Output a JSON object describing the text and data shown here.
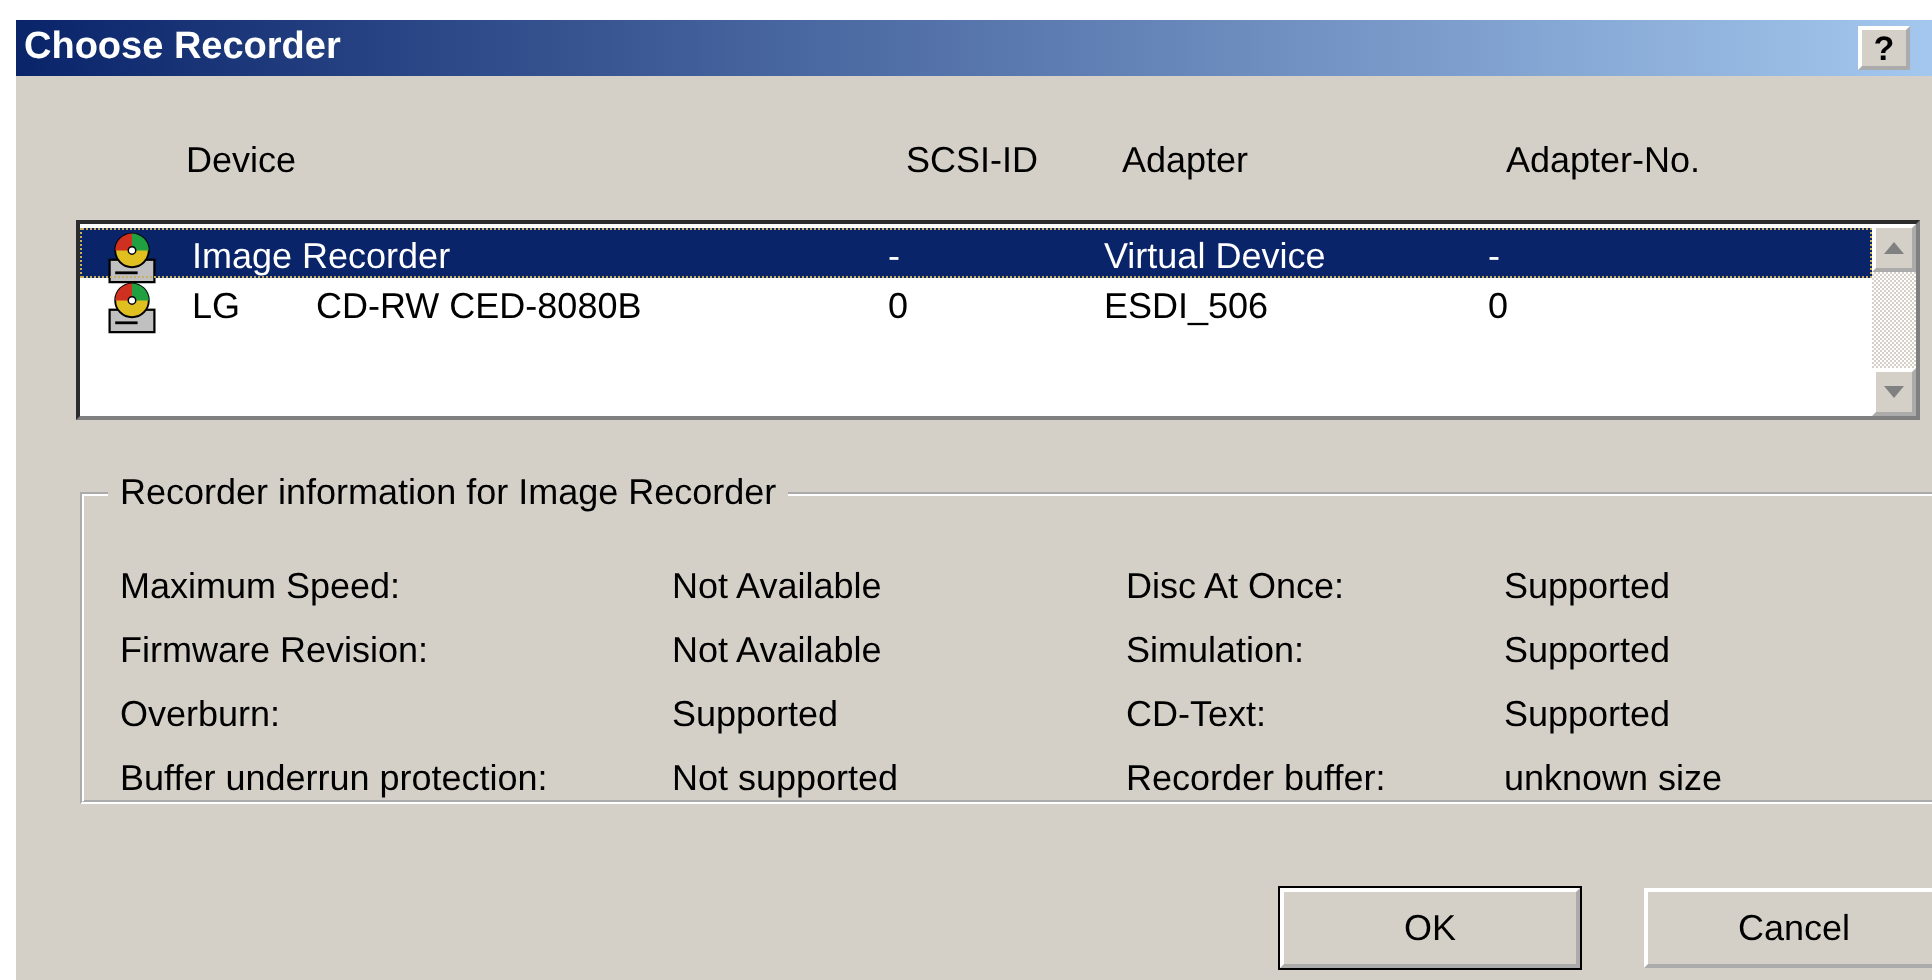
{
  "window": {
    "title": "Choose Recorder",
    "help_button": "?"
  },
  "table": {
    "columns": [
      "Device",
      "SCSI-ID",
      "Adapter",
      "Adapter-No."
    ],
    "rows": [
      {
        "device": "Image Recorder",
        "scsi_id": "-",
        "adapter": "Virtual Device",
        "adapter_no": "-",
        "selected": true
      },
      {
        "device": "LG",
        "model": "CD-RW CED-8080B",
        "scsi_id": "0",
        "adapter": "ESDI_506",
        "adapter_no": "0",
        "selected": false
      }
    ]
  },
  "info": {
    "title": "Recorder information for Image Recorder",
    "items": [
      {
        "label": "Maximum Speed:",
        "value": "Not Available"
      },
      {
        "label": "Disc At Once:",
        "value": "Supported"
      },
      {
        "label": "Firmware Revision:",
        "value": "Not Available"
      },
      {
        "label": "Simulation:",
        "value": "Supported"
      },
      {
        "label": "Overburn:",
        "value": "Supported"
      },
      {
        "label": "CD-Text:",
        "value": "Supported"
      },
      {
        "label": "Buffer underrun protection:",
        "value": "Not supported"
      },
      {
        "label": "Recorder buffer:",
        "value": "unknown size"
      }
    ]
  },
  "buttons": [
    "OK",
    "Cancel"
  ]
}
